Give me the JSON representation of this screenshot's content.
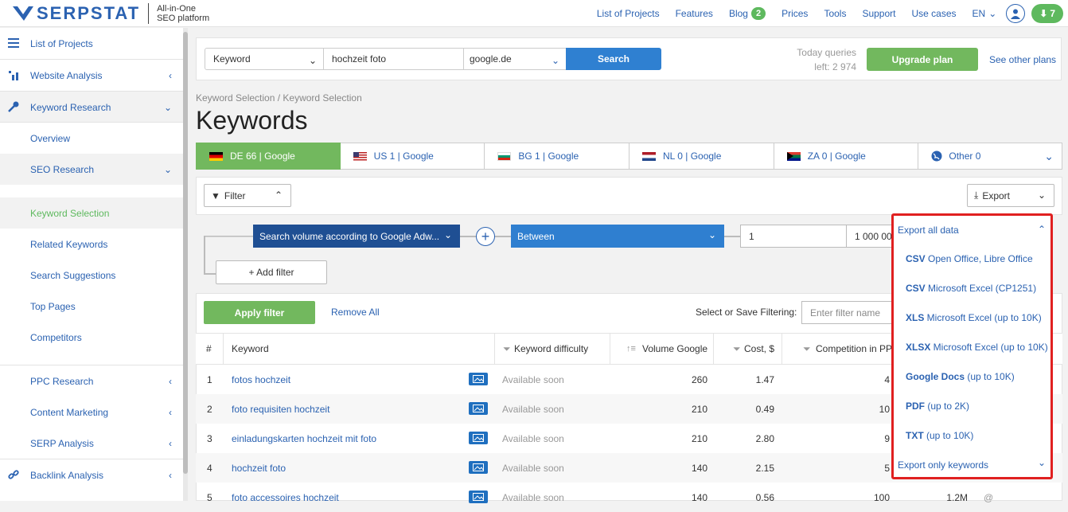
{
  "header": {
    "logo_text": "SERPSTAT",
    "tagline_1": "All-in-One",
    "tagline_2": "SEO platform",
    "nav": [
      "List of Projects",
      "Features",
      "Blog",
      "Prices",
      "Tools",
      "Support",
      "Use cases"
    ],
    "blog_badge": "2",
    "lang": "EN",
    "downloads_count": "7"
  },
  "sidebar": {
    "items": [
      {
        "label": "List of Projects",
        "icon": "list-icon"
      },
      {
        "label": "Website Analysis",
        "icon": "chart-icon"
      },
      {
        "label": "Keyword Research",
        "icon": "key-icon"
      },
      {
        "label": "Overview"
      },
      {
        "label": "SEO Research"
      },
      {
        "label": "Keyword Selection"
      },
      {
        "label": "Related Keywords"
      },
      {
        "label": "Search Suggestions"
      },
      {
        "label": "Top Pages"
      },
      {
        "label": "Competitors"
      },
      {
        "label": "PPC Research"
      },
      {
        "label": "Content Marketing"
      },
      {
        "label": "SERP Analysis"
      },
      {
        "label": "Backlink Analysis",
        "icon": "link-icon"
      }
    ]
  },
  "search": {
    "type": "Keyword",
    "query": "hochzeit foto",
    "engine": "google.de",
    "button": "Search",
    "queries_label_1": "Today queries",
    "queries_label_2": "left: 2 974",
    "upgrade": "Upgrade plan",
    "other_plans": "See other plans"
  },
  "breadcrumb": "Keyword Selection / Keyword Selection",
  "page_title": "Keywords",
  "db_tabs": [
    {
      "label": "DE 66 | Google",
      "flag": "de"
    },
    {
      "label": "US 1 | Google",
      "flag": "us"
    },
    {
      "label": "BG 1 | Google",
      "flag": "bg"
    },
    {
      "label": "NL 0 | Google",
      "flag": "nl"
    },
    {
      "label": "ZA 0 | Google",
      "flag": "za"
    },
    {
      "label": "Other 0",
      "flag": "globe"
    }
  ],
  "filter": {
    "toggle": "Filter",
    "export": "Export",
    "condition_field": "Search volume according to Google Adw...",
    "condition_op": "Between",
    "from": "1",
    "to": "1 000 00",
    "add_filter": "+ Add filter",
    "apply": "Apply filter",
    "remove_all": "Remove All",
    "save_label": "Select or Save Filtering:",
    "save_placeholder": "Enter filter name"
  },
  "table": {
    "headers": [
      "#",
      "Keyword",
      "Keyword difficulty",
      "Volume Google",
      "Cost, $",
      "Competition in PPC"
    ],
    "rows": [
      {
        "n": "1",
        "kw": "fotos hochzeit",
        "kd": "Available soon",
        "vol": "260",
        "cost": "1.47",
        "comp": "4"
      },
      {
        "n": "2",
        "kw": "foto requisiten hochzeit",
        "kd": "Available soon",
        "vol": "210",
        "cost": "0.49",
        "comp": "10"
      },
      {
        "n": "3",
        "kw": "einladungskarten hochzeit mit foto",
        "kd": "Available soon",
        "vol": "210",
        "cost": "2.80",
        "comp": "9"
      },
      {
        "n": "4",
        "kw": "hochzeit foto",
        "kd": "Available soon",
        "vol": "140",
        "cost": "2.15",
        "comp": "5"
      },
      {
        "n": "5",
        "kw": "foto accessoires hochzeit",
        "kd": "Available soon",
        "vol": "140",
        "cost": "0.56",
        "comp": "100",
        "results": "1.2M"
      }
    ]
  },
  "export_menu": {
    "all_data": "Export all data",
    "items": [
      {
        "bold": "CSV",
        "rest": " Open Office, Libre Office"
      },
      {
        "bold": "CSV",
        "rest": " Microsoft Excel (CP1251)"
      },
      {
        "bold": "XLS",
        "rest": " Microsoft Excel (up to 10K)"
      },
      {
        "bold": "XLSX",
        "rest": " Microsoft Excel (up to 10K)"
      },
      {
        "bold": "Google Docs",
        "rest": " (up to 10K)"
      },
      {
        "bold": "PDF",
        "rest": " (up to 2K)"
      },
      {
        "bold": "TXT",
        "rest": " (up to 10K)"
      }
    ],
    "only_keywords": "Export only keywords"
  },
  "colors": {
    "brand": "#2b62b1",
    "green": "#72b85e",
    "highlight": "#e02020"
  }
}
